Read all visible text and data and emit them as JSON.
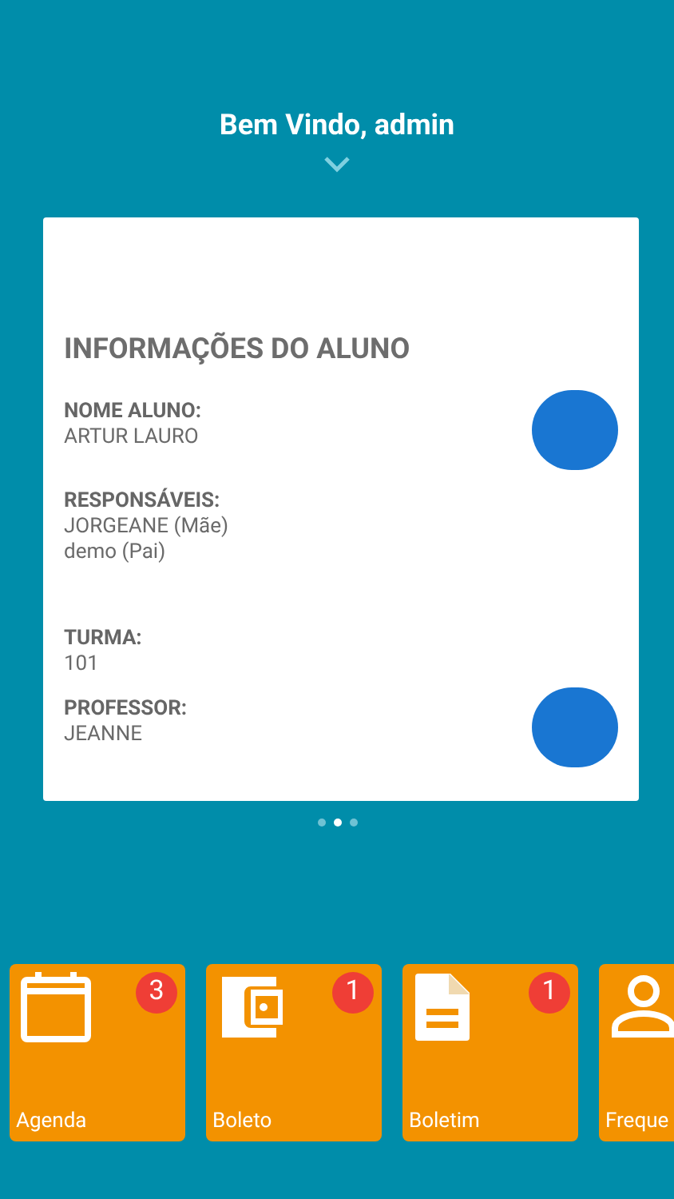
{
  "header": {
    "greeting": "Bem Vindo, admin"
  },
  "card": {
    "title": "INFORMAÇÕES DO ALUNO",
    "sections": [
      {
        "label": "NOME ALUNO:",
        "lines": [
          "ARTUR LAURO"
        ],
        "avatar": true
      },
      {
        "label": "RESPONSÁVEIS:",
        "lines": [
          "JORGEANE (Mãe)",
          "demo (Pai)"
        ],
        "avatar": false
      },
      {
        "label": "TURMA:",
        "lines": [
          "101"
        ],
        "avatar": false
      },
      {
        "label": "PROFESSOR:",
        "lines": [
          "JEANNE"
        ],
        "avatar": true
      }
    ]
  },
  "pager": [
    {
      "selected": false
    },
    {
      "selected": true
    },
    {
      "selected": false
    }
  ],
  "tiles": [
    {
      "kind": "calendar",
      "label": "Agenda",
      "badge": "3"
    },
    {
      "kind": "wallet",
      "label": "Boleto",
      "badge": "1"
    },
    {
      "kind": "document",
      "label": "Boletim",
      "badge": "1"
    },
    {
      "kind": "person",
      "label": "Freque"
    }
  ]
}
